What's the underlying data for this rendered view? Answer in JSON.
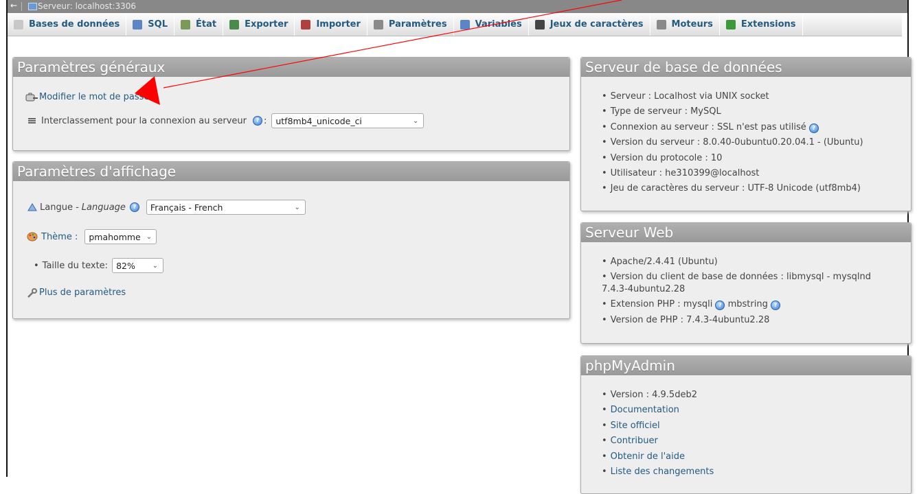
{
  "topbar": {
    "back_icon": "←",
    "server_label": "Serveur: localhost:3306"
  },
  "tabs": [
    {
      "label": "Bases de données",
      "icon": "database-icon",
      "color": "#c8c8c8"
    },
    {
      "label": "SQL",
      "icon": "sql-icon",
      "color": "#5a86c8"
    },
    {
      "label": "État",
      "icon": "status-icon",
      "color": "#7a9a5a"
    },
    {
      "label": "Exporter",
      "icon": "export-icon",
      "color": "#4a8a4a"
    },
    {
      "label": "Importer",
      "icon": "import-icon",
      "color": "#b04040"
    },
    {
      "label": "Paramètres",
      "icon": "wrench-icon",
      "color": "#8a8a8a"
    },
    {
      "label": "Variables",
      "icon": "variables-icon",
      "color": "#5a86c8"
    },
    {
      "label": "Jeux de caractères",
      "icon": "charset-icon",
      "color": "#444444"
    },
    {
      "label": "Moteurs",
      "icon": "engines-icon",
      "color": "#8a8a8a"
    },
    {
      "label": "Extensions",
      "icon": "extensions-icon",
      "color": "#3a9a3a"
    }
  ],
  "general": {
    "title": "Paramètres généraux",
    "change_password": "Modifier le mot de passe",
    "collation_label": "Interclassement pour la connexion au serveur",
    "collation_value": "utf8mb4_unicode_ci"
  },
  "display": {
    "title": "Paramètres d'affichage",
    "language_label": "Langue - ",
    "language_italic": "Language",
    "language_value": "Français - French",
    "theme_label": "Thème :",
    "theme_value": "pmahomme",
    "font_size_label": "Taille du texte:",
    "font_size_value": "82%",
    "more_settings": "Plus de paramètres"
  },
  "db_server": {
    "title": "Serveur de base de données",
    "items": [
      "Serveur : Localhost via UNIX socket",
      "Type de serveur : MySQL",
      "Connexion au serveur : SSL n'est pas utilisé",
      "Version du serveur : 8.0.40-0ubuntu0.20.04.1 - (Ubuntu)",
      "Version du protocole : 10",
      "Utilisateur : he310399@localhost",
      "Jeu de caractères du serveur : UTF-8 Unicode (utf8mb4)"
    ]
  },
  "web_server": {
    "title": "Serveur Web",
    "items": [
      "Apache/2.4.41 (Ubuntu)",
      "Version du client de base de données : libmysql - mysqlnd 7.4.3-4ubuntu2.28",
      "Extension PHP : mysqli",
      "mbstring",
      "Version de PHP : 7.4.3-4ubuntu2.28"
    ]
  },
  "phpmyadmin": {
    "title": "phpMyAdmin",
    "version": "Version : 4.9.5deb2",
    "links": [
      "Documentation",
      "Site officiel",
      "Contribuer",
      "Obtenir de l'aide",
      "Liste des changements"
    ]
  },
  "annotation": {
    "arrow_color": "#ff0000"
  }
}
